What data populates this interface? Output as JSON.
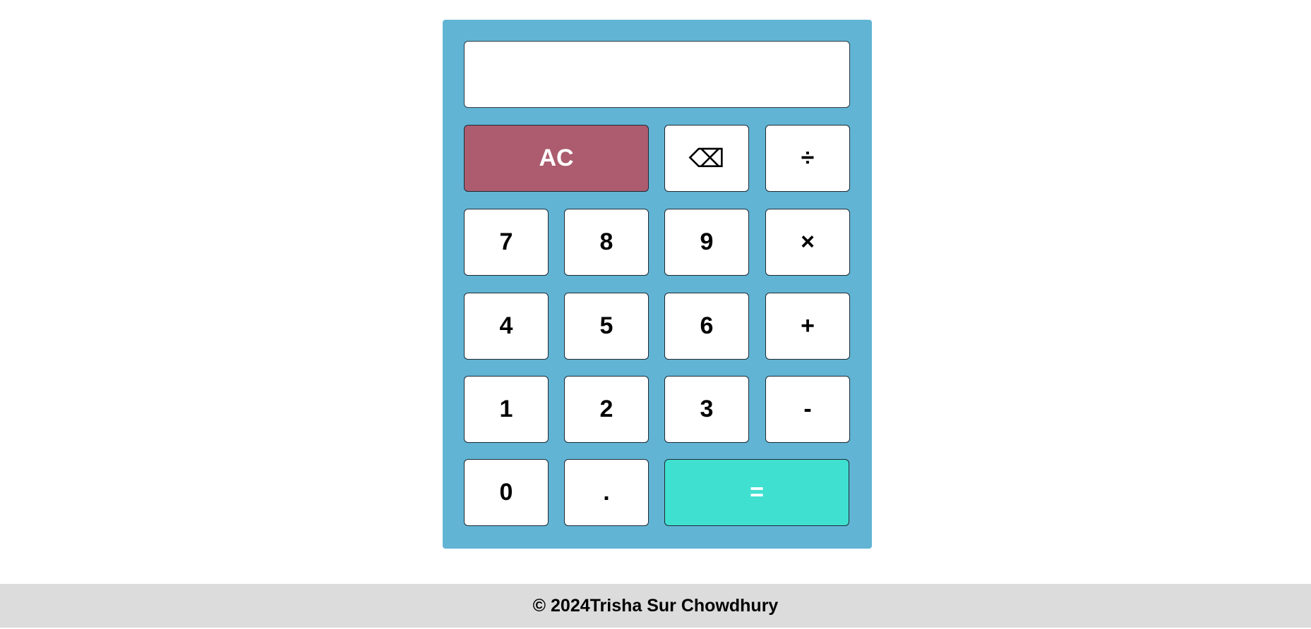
{
  "display": {
    "value": "",
    "placeholder": ""
  },
  "keys": {
    "clear": "AC",
    "backspace": "⌫",
    "divide": "÷",
    "seven": "7",
    "eight": "8",
    "nine": "9",
    "multiply": "×",
    "four": "4",
    "five": "5",
    "six": "6",
    "plus": "+",
    "one": "1",
    "two": "2",
    "three": "3",
    "minus": "-",
    "zero": "0",
    "dot": ".",
    "equals": "="
  },
  "footer": {
    "text": "© 2024Trisha Sur Chowdhury"
  },
  "colors": {
    "calculator_bg": "#61b4d4",
    "clear_bg": "#ac5c6e",
    "equals_bg": "#40e0d0",
    "footer_bg": "#dcdcdc"
  }
}
